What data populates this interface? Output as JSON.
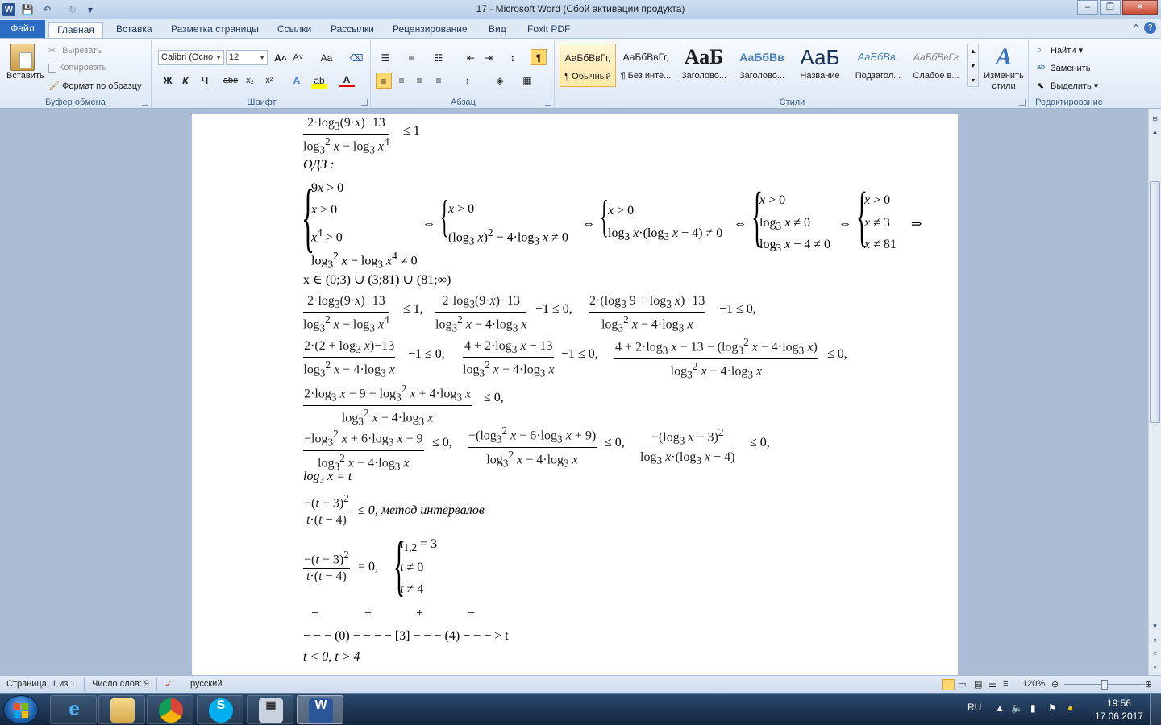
{
  "window": {
    "title": "17 - Microsoft Word (Сбой активации продукта)",
    "buttons": {
      "minimize": "–",
      "restore": "❐",
      "close": "✕"
    }
  },
  "qat": {
    "save": "💾",
    "undo": "↶",
    "redo": "↻",
    "customize": "▾"
  },
  "tabs": [
    "Файл",
    "Главная",
    "Вставка",
    "Разметка страницы",
    "Ссылки",
    "Рассылки",
    "Рецензирование",
    "Вид",
    "Foxit PDF"
  ],
  "ribbon": {
    "clipboard": {
      "paste": "Вставить",
      "cut": "Вырезать",
      "copy": "Копировать",
      "format_painter": "Формат по образцу",
      "label": "Буфер обмена"
    },
    "font": {
      "family": "Calibri (Осно",
      "size": "12",
      "bold": "Ж",
      "italic": "К",
      "underline": "Ч",
      "strike": "abe",
      "sub": "x₂",
      "sup": "x²",
      "grow": "A˄",
      "shrink": "A˅",
      "case": "Aa",
      "label": "Шрифт"
    },
    "paragraph": {
      "label": "Абзац"
    },
    "styles": {
      "tiles": [
        {
          "preview": "АаБбВвГг,",
          "name": "¶ Обычный"
        },
        {
          "preview": "АаБбВвГг,",
          "name": "¶ Без инте..."
        },
        {
          "preview": "АаБ",
          "name": "Заголово..."
        },
        {
          "preview": "АаБбВв",
          "name": "Заголово..."
        },
        {
          "preview": "АаБ",
          "name": "Название"
        },
        {
          "preview": "АаБбВв.",
          "name": "Подзагол..."
        },
        {
          "preview": "АаБбВвГг",
          "name": "Слабое в..."
        }
      ],
      "change": "Изменить стили",
      "label": "Стили"
    },
    "editing": {
      "find": "Найти",
      "replace": "Заменить",
      "select": "Выделить",
      "label": "Редактирование"
    }
  },
  "document": {
    "odz": "ОДЗ :",
    "domain_line": "x ∈ (0;3) ∪ (3;81) ∪ (81;∞)",
    "sub_line": "log₃ x = t",
    "interval_note": "≤ 0, метод интервалов",
    "signs": [
      "−",
      "+",
      "+",
      "−"
    ],
    "number_line": "− − − (0) − − − − [3] − − − (4) − − − > t",
    "answer": "t < 0,    t > 4"
  },
  "status": {
    "page": "Страница: 1 из 1",
    "words": "Число слов: 9",
    "lang": "русский",
    "zoom": "120%"
  },
  "taskbar": {
    "lang": "RU",
    "time": "19:56",
    "date": "17.06.2017"
  }
}
